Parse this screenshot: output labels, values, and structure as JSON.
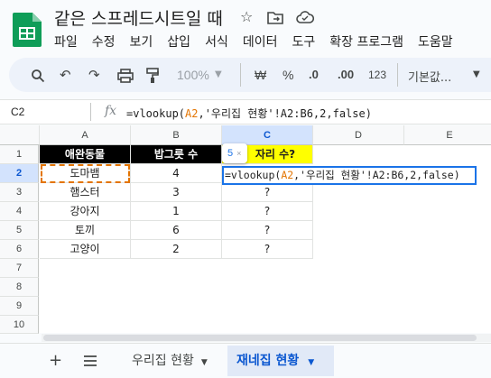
{
  "doc": {
    "title": "같은 스프레드시트일 때"
  },
  "menu": [
    "파일",
    "수정",
    "보기",
    "삽입",
    "서식",
    "데이터",
    "도구",
    "확장 프로그램",
    "도움말"
  ],
  "toolbar": {
    "zoom": "100%",
    "currency": "₩",
    "percent": "%",
    "dec_decrease": ".0",
    "dec_increase": ".00",
    "number_format": "123",
    "font": "기본값..."
  },
  "formula_bar": {
    "cell_ref": "C2",
    "prefix": "=vlookup(",
    "arg_a2": "A2",
    "rest": ",'우리집 현황'!A2:B6,2,false)"
  },
  "columns": [
    "A",
    "B",
    "C",
    "D",
    "E"
  ],
  "rows": [
    "1",
    "2",
    "3",
    "4",
    "5",
    "6",
    "7",
    "8",
    "9",
    "10"
  ],
  "table": {
    "header": [
      "애완동물",
      "밥그릇 수",
      "자리 수?"
    ],
    "data": [
      [
        "도마뱀",
        "4"
      ],
      [
        "햄스터",
        "3",
        "?"
      ],
      [
        "강아지",
        "1",
        "?"
      ],
      [
        "토끼",
        "6",
        "?"
      ],
      [
        "고양이",
        "2",
        "?"
      ]
    ]
  },
  "editor": {
    "prefix": "=vlookup(",
    "arg_a2": "A2",
    "rest": ",'우리집 현황'!A2:B6,2,false)",
    "tooltip": "5"
  },
  "sheets": [
    {
      "name": "우리집 현황"
    },
    {
      "name": "재네집 현황"
    }
  ],
  "colors": {
    "accent": "#1a73e8",
    "header_black": "#000000",
    "header_yellow": "#ffff00",
    "active_tab_bg": "#e1e9f7"
  }
}
